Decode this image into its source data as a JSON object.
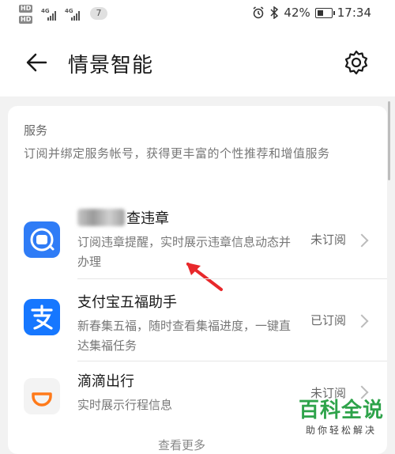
{
  "status_bar": {
    "hd1": "HD",
    "hd2": "HD",
    "net1": "4G",
    "net2": "4G",
    "notification_count": "7",
    "battery_percent": "42%",
    "time": "17:34",
    "battery_level": 0.42
  },
  "header": {
    "title": "情景智能"
  },
  "section": {
    "title": "服务",
    "description": "订阅并绑定服务帐号，获得更丰富的个性推荐和增值服务"
  },
  "services": [
    {
      "name": "查违章",
      "desc": "订阅违章提醒，实时展示违章信息动态并办理",
      "status": "未订阅",
      "icon": "traffic-violation-icon",
      "color": "#2f7cf6"
    },
    {
      "name": "支付宝五福助手",
      "desc": "新春集五福，随时查看集福进度，一键直达集福任务",
      "status": "已订阅",
      "icon": "alipay-icon",
      "color": "#1677ff"
    },
    {
      "name": "滴滴出行",
      "desc": "实时展示行程信息",
      "status": "未订阅",
      "icon": "didi-icon",
      "color": "#ff7a1a"
    }
  ],
  "more_text": "查看更多",
  "watermark": {
    "main": "百科全说",
    "sub": "助你轻松解决"
  }
}
